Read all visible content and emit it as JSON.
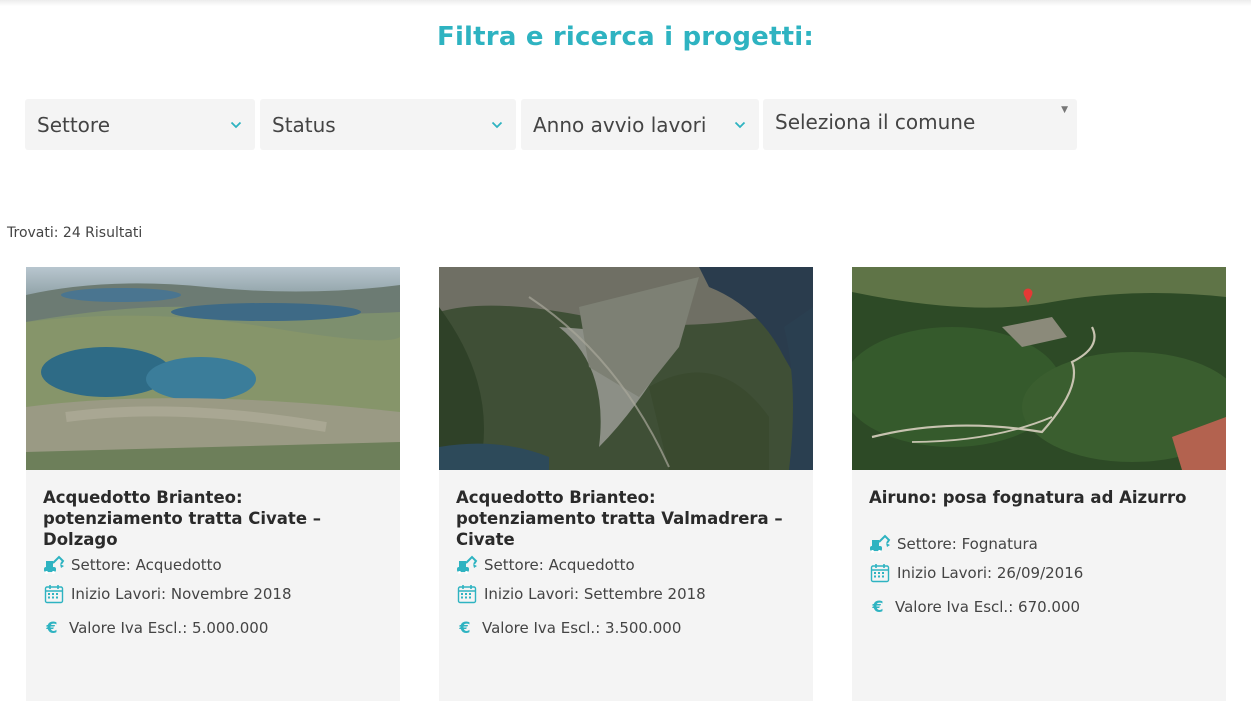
{
  "header": {
    "title": "Filtra e ricerca i progetti:"
  },
  "filters": [
    {
      "label": "Settore"
    },
    {
      "label": "Status"
    },
    {
      "label": "Anno avvio lavori"
    },
    {
      "label": "Seleziona il comune"
    }
  ],
  "results": {
    "text": "Trovati: 24 Risultati"
  },
  "colors": {
    "accent": "#2eb3c1",
    "card_bg": "#f4f4f4",
    "filter_bg": "#f4f4f4"
  },
  "cards": [
    {
      "title": "Acquedotto Brianteo: potenziamento tratta Civate – Dolzago",
      "settore": "Settore: Acquedotto",
      "inizio": "Inizio Lavori: Novembre 2018",
      "valore": "Valore Iva Escl.: 5.000.000"
    },
    {
      "title": "Acquedotto Brianteo: potenziamento tratta Valmadrera – Civate",
      "settore": "Settore: Acquedotto",
      "inizio": "Inizio Lavori: Settembre 2018",
      "valore": "Valore Iva Escl.: 3.500.000"
    },
    {
      "title": "Airuno: posa fognatura ad Aizurro",
      "settore": "Settore: Fognatura",
      "inizio": "Inizio Lavori: 26/09/2016",
      "valore": "Valore Iva Escl.: 670.000"
    }
  ],
  "icons": {
    "sector": "excavator-icon",
    "date": "calendar-icon",
    "value": "euro-icon",
    "dropdown": "chevron-down-icon"
  }
}
